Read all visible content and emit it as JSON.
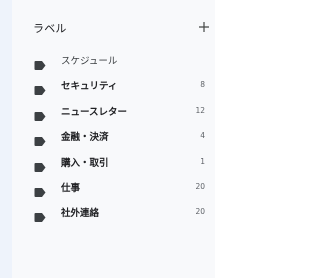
{
  "labels_panel": {
    "title": "ラベル",
    "add_icon": "plus-icon",
    "tag_icon": "label-tag-icon",
    "items": [
      {
        "name": "スケジュール",
        "count": "",
        "unread": false
      },
      {
        "name": "セキュリティ",
        "count": "8",
        "unread": true
      },
      {
        "name": "ニュースレター",
        "count": "12",
        "unread": true
      },
      {
        "name": "金融・決済",
        "count": "4",
        "unread": true
      },
      {
        "name": "購入・取引",
        "count": "1",
        "unread": true
      },
      {
        "name": "仕事",
        "count": "20",
        "unread": true
      },
      {
        "name": "社外連絡",
        "count": "20",
        "unread": true
      }
    ]
  },
  "colors": {
    "panel_bg": "#f8f9fb",
    "outer_bg": "#eef3fb",
    "text": "#202124",
    "icon": "#3c4043",
    "count": "#5f6368"
  }
}
